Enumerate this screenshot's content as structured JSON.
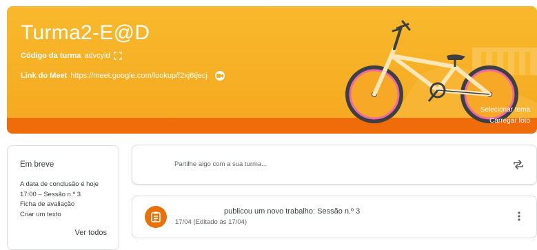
{
  "banner": {
    "title": "Turma2-E@D",
    "class_code_label": "Código da turma",
    "class_code": "advcyid",
    "meet_label": "Link do Meet",
    "meet_link": "https://meet.google.com/lookup/f2xj6tjecj",
    "select_theme": "Selecionar tema",
    "upload_photo": "Carregar foto",
    "theme_color": "#f6ad22",
    "accent_orange": "#f06b0a"
  },
  "upcoming": {
    "title": "Em breve",
    "due_text": "A data de conclusão é hoje",
    "items": [
      "17:00 – Sessão n.º 3",
      "Ficha de avaliação",
      "Criar um texto"
    ],
    "view_all": "Ver todos"
  },
  "share": {
    "placeholder": "Partilhe algo com a sua turma...",
    "icon": "repost-icon"
  },
  "post": {
    "icon": "assignment-icon",
    "title": "publicou um novo trabalho: Sessão n.º 3",
    "date": "17/04 (Editado às 17/04)",
    "menu_icon": "more-vert-icon"
  }
}
